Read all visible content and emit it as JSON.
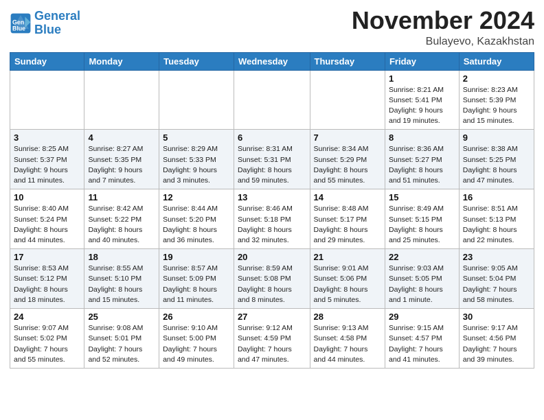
{
  "header": {
    "logo_line1": "General",
    "logo_line2": "Blue",
    "month_title": "November 2024",
    "location": "Bulayevo, Kazakhstan"
  },
  "weekdays": [
    "Sunday",
    "Monday",
    "Tuesday",
    "Wednesday",
    "Thursday",
    "Friday",
    "Saturday"
  ],
  "weeks": [
    [
      {
        "day": "",
        "info": ""
      },
      {
        "day": "",
        "info": ""
      },
      {
        "day": "",
        "info": ""
      },
      {
        "day": "",
        "info": ""
      },
      {
        "day": "",
        "info": ""
      },
      {
        "day": "1",
        "info": "Sunrise: 8:21 AM\nSunset: 5:41 PM\nDaylight: 9 hours\nand 19 minutes."
      },
      {
        "day": "2",
        "info": "Sunrise: 8:23 AM\nSunset: 5:39 PM\nDaylight: 9 hours\nand 15 minutes."
      }
    ],
    [
      {
        "day": "3",
        "info": "Sunrise: 8:25 AM\nSunset: 5:37 PM\nDaylight: 9 hours\nand 11 minutes."
      },
      {
        "day": "4",
        "info": "Sunrise: 8:27 AM\nSunset: 5:35 PM\nDaylight: 9 hours\nand 7 minutes."
      },
      {
        "day": "5",
        "info": "Sunrise: 8:29 AM\nSunset: 5:33 PM\nDaylight: 9 hours\nand 3 minutes."
      },
      {
        "day": "6",
        "info": "Sunrise: 8:31 AM\nSunset: 5:31 PM\nDaylight: 8 hours\nand 59 minutes."
      },
      {
        "day": "7",
        "info": "Sunrise: 8:34 AM\nSunset: 5:29 PM\nDaylight: 8 hours\nand 55 minutes."
      },
      {
        "day": "8",
        "info": "Sunrise: 8:36 AM\nSunset: 5:27 PM\nDaylight: 8 hours\nand 51 minutes."
      },
      {
        "day": "9",
        "info": "Sunrise: 8:38 AM\nSunset: 5:25 PM\nDaylight: 8 hours\nand 47 minutes."
      }
    ],
    [
      {
        "day": "10",
        "info": "Sunrise: 8:40 AM\nSunset: 5:24 PM\nDaylight: 8 hours\nand 44 minutes."
      },
      {
        "day": "11",
        "info": "Sunrise: 8:42 AM\nSunset: 5:22 PM\nDaylight: 8 hours\nand 40 minutes."
      },
      {
        "day": "12",
        "info": "Sunrise: 8:44 AM\nSunset: 5:20 PM\nDaylight: 8 hours\nand 36 minutes."
      },
      {
        "day": "13",
        "info": "Sunrise: 8:46 AM\nSunset: 5:18 PM\nDaylight: 8 hours\nand 32 minutes."
      },
      {
        "day": "14",
        "info": "Sunrise: 8:48 AM\nSunset: 5:17 PM\nDaylight: 8 hours\nand 29 minutes."
      },
      {
        "day": "15",
        "info": "Sunrise: 8:49 AM\nSunset: 5:15 PM\nDaylight: 8 hours\nand 25 minutes."
      },
      {
        "day": "16",
        "info": "Sunrise: 8:51 AM\nSunset: 5:13 PM\nDaylight: 8 hours\nand 22 minutes."
      }
    ],
    [
      {
        "day": "17",
        "info": "Sunrise: 8:53 AM\nSunset: 5:12 PM\nDaylight: 8 hours\nand 18 minutes."
      },
      {
        "day": "18",
        "info": "Sunrise: 8:55 AM\nSunset: 5:10 PM\nDaylight: 8 hours\nand 15 minutes."
      },
      {
        "day": "19",
        "info": "Sunrise: 8:57 AM\nSunset: 5:09 PM\nDaylight: 8 hours\nand 11 minutes."
      },
      {
        "day": "20",
        "info": "Sunrise: 8:59 AM\nSunset: 5:08 PM\nDaylight: 8 hours\nand 8 minutes."
      },
      {
        "day": "21",
        "info": "Sunrise: 9:01 AM\nSunset: 5:06 PM\nDaylight: 8 hours\nand 5 minutes."
      },
      {
        "day": "22",
        "info": "Sunrise: 9:03 AM\nSunset: 5:05 PM\nDaylight: 8 hours\nand 1 minute."
      },
      {
        "day": "23",
        "info": "Sunrise: 9:05 AM\nSunset: 5:04 PM\nDaylight: 7 hours\nand 58 minutes."
      }
    ],
    [
      {
        "day": "24",
        "info": "Sunrise: 9:07 AM\nSunset: 5:02 PM\nDaylight: 7 hours\nand 55 minutes."
      },
      {
        "day": "25",
        "info": "Sunrise: 9:08 AM\nSunset: 5:01 PM\nDaylight: 7 hours\nand 52 minutes."
      },
      {
        "day": "26",
        "info": "Sunrise: 9:10 AM\nSunset: 5:00 PM\nDaylight: 7 hours\nand 49 minutes."
      },
      {
        "day": "27",
        "info": "Sunrise: 9:12 AM\nSunset: 4:59 PM\nDaylight: 7 hours\nand 47 minutes."
      },
      {
        "day": "28",
        "info": "Sunrise: 9:13 AM\nSunset: 4:58 PM\nDaylight: 7 hours\nand 44 minutes."
      },
      {
        "day": "29",
        "info": "Sunrise: 9:15 AM\nSunset: 4:57 PM\nDaylight: 7 hours\nand 41 minutes."
      },
      {
        "day": "30",
        "info": "Sunrise: 9:17 AM\nSunset: 4:56 PM\nDaylight: 7 hours\nand 39 minutes."
      }
    ]
  ]
}
